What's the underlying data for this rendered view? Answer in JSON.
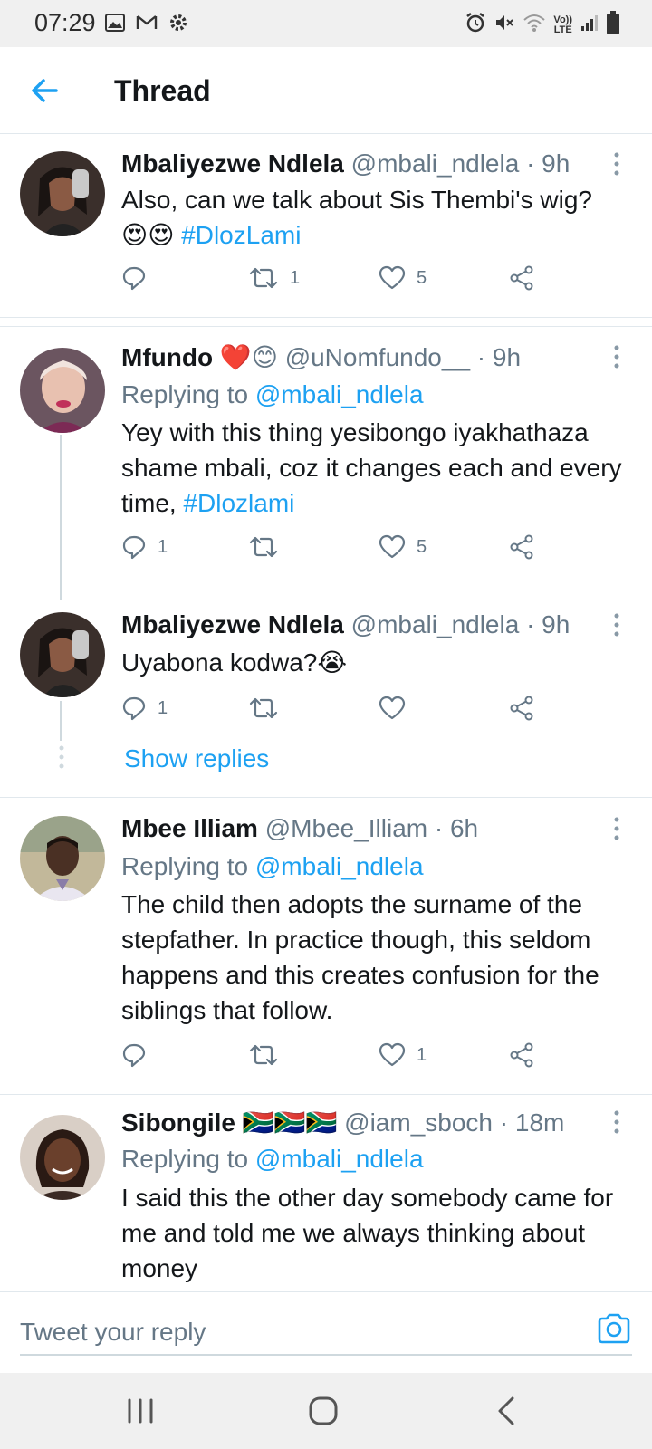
{
  "status_bar": {
    "time": "07:29",
    "left_icons": [
      "image-icon",
      "gmail-icon",
      "settings-gear-icon"
    ],
    "right_icons": [
      "alarm-icon",
      "mute-icon",
      "wifi-icon",
      "volte-lte-indicator",
      "signal-icon",
      "battery-icon"
    ],
    "volte_top": "Vo))",
    "volte_bottom": "LTE"
  },
  "header": {
    "title": "Thread",
    "back_icon": "arrow-left-icon"
  },
  "tweets": [
    {
      "name": "Mbaliyezwe Ndlela",
      "handle": "@mbali_ndlela",
      "time": "· 9h",
      "text_plain": "Also, can we talk about Sis Thembi's wig?",
      "emoji": "😍😍",
      "hashtag": "#DlozLami",
      "replies": "",
      "retweets": "1",
      "likes": "5"
    },
    {
      "name": "Mfundo",
      "name_emoji": "❤️😊",
      "handle": "@uNomfundo__",
      "time": "· 9h",
      "replying_label": "Replying to",
      "replying_handle": "@mbali_ndlela",
      "text_plain": "Yey with this thing yesibongo iyakhathaza shame mbali, coz it changes each and every time,",
      "hashtag": "#Dlozlami",
      "replies": "1",
      "retweets": "",
      "likes": "5"
    },
    {
      "name": "Mbaliyezwe Ndlela",
      "handle": "@mbali_ndlela",
      "time": "· 9h",
      "text_plain": "Uyabona kodwa?",
      "emoji": "😭",
      "replies": "1",
      "retweets": "",
      "likes": ""
    },
    {
      "name": "Mbee Illiam",
      "handle": "@Mbee_Illiam",
      "time": "· 6h",
      "replying_label": "Replying to",
      "replying_handle": "@mbali_ndlela",
      "text_plain": "The child then adopts the surname of the stepfather. In practice though, this seldom happens and this creates confusion for the siblings that follow.",
      "replies": "",
      "retweets": "",
      "likes": "1"
    },
    {
      "name": "Sibongile",
      "name_emoji": "🇿🇦🇿🇦🇿🇦",
      "handle": "@iam_sboch",
      "time": "· 18m",
      "replying_label": "Replying to",
      "replying_handle": "@mbali_ndlela",
      "text_plain": "I said this the other day somebody came for me and told me we always thinking about money"
    }
  ],
  "show_replies": "Show replies",
  "reply_bar": {
    "placeholder": "Tweet your reply",
    "camera_icon": "camera-icon"
  },
  "nav_bar": {
    "icons": [
      "recent-apps-icon",
      "home-icon",
      "back-icon"
    ]
  },
  "colors": {
    "accent": "#1da1f2",
    "secondary_text": "#657786",
    "primary_text": "#14171a",
    "divider": "#e1e8ed"
  }
}
